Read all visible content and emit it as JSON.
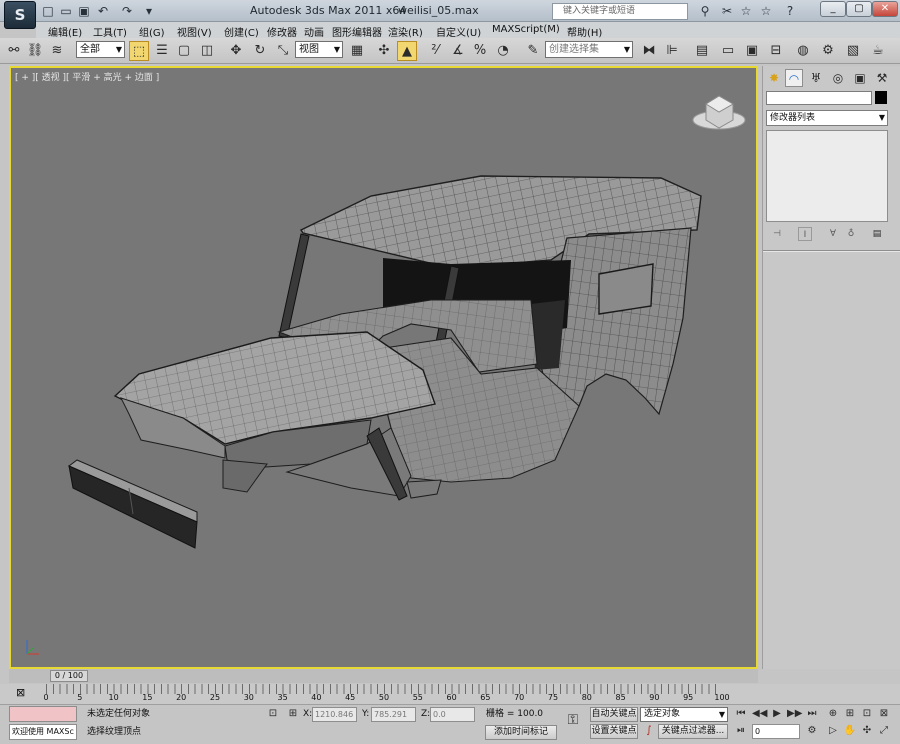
{
  "titlebar": {
    "logo": "S",
    "quick_access": [
      "□",
      "▭",
      "▣",
      "↶",
      "↷",
      "▾"
    ],
    "title": "Autodesk 3ds Max  2011 x64",
    "file": "weilisi_05.max",
    "search_placeholder": "键入关键字或短语",
    "right_icons": [
      "⚲",
      "✂",
      "☆",
      "?"
    ],
    "window_controls": [
      "_",
      "▢",
      "✕"
    ]
  },
  "menus": [
    "编辑(E)",
    "工具(T)",
    "组(G)",
    "视图(V)",
    "创建(C)",
    "修改器",
    "动画",
    "图形编辑器",
    "渲染(R)",
    "自定义(U)",
    "MAXScript(M)",
    "帮助(H)"
  ],
  "toolbar": {
    "selection_filter": "全部",
    "reference_coord": "视图",
    "named_selection_placeholder": "创建选择集"
  },
  "viewport": {
    "label": "[ + ][ 透视 ][ 平滑 + 高光 + 边面 ]"
  },
  "command_panel": {
    "modifier_list": "修改器列表"
  },
  "time_slider": {
    "label": "0 / 100"
  },
  "ruler": {
    "ticks": [
      "0",
      "5",
      "10",
      "15",
      "20",
      "25",
      "30",
      "35",
      "40",
      "45",
      "50",
      "55",
      "60",
      "65",
      "70",
      "75",
      "80",
      "85",
      "90",
      "95",
      "100"
    ]
  },
  "status": {
    "welcome": "欢迎使用 MAXSc",
    "prompt_line1": "未选定任何对象",
    "prompt_line2": "选择纹理顶点",
    "x_label": "X:",
    "x_value": "1210.846",
    "y_label": "Y:",
    "y_value": "785.291",
    "z_label": "Z:",
    "z_value": "0.0",
    "grid": "栅格 = 100.0",
    "add_time_tag": "添加时间标记",
    "auto_key": "自动关键点",
    "set_key": "设置关键点",
    "selected_dd": "选定对象",
    "key_filters": "关键点过滤器...",
    "frame_value": "0"
  }
}
